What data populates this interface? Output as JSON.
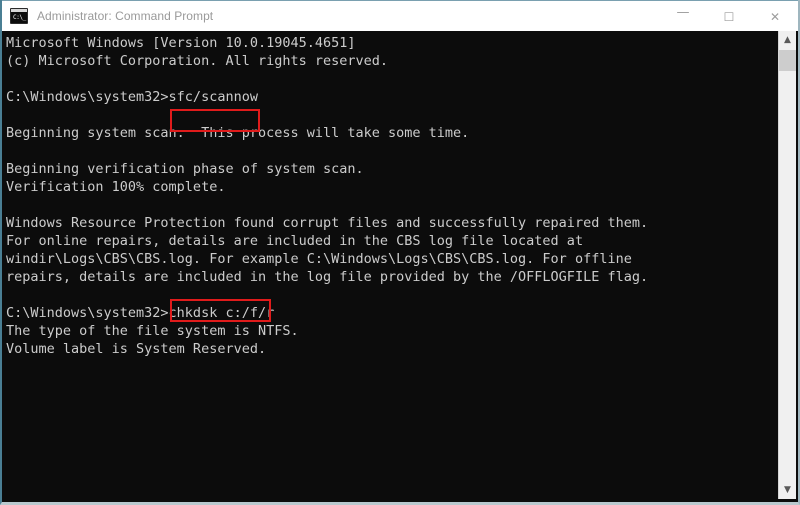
{
  "window": {
    "title": "Administrator: Command Prompt",
    "icon": "cmd-icon",
    "icon_prompt_text": "C:\\_",
    "controls": {
      "minimize": "—",
      "maximize": "☐",
      "close": "✕"
    }
  },
  "console": {
    "lines": [
      "Microsoft Windows [Version 10.0.19045.4651]",
      "(c) Microsoft Corporation. All rights reserved.",
      "",
      "C:\\Windows\\system32>sfc/scannow",
      "",
      "Beginning system scan.  This process will take some time.",
      "",
      "Beginning verification phase of system scan.",
      "Verification 100% complete.",
      "",
      "Windows Resource Protection found corrupt files and successfully repaired them.",
      "For online repairs, details are included in the CBS log file located at",
      "windir\\Logs\\CBS\\CBS.log. For example C:\\Windows\\Logs\\CBS\\CBS.log. For offline",
      "repairs, details are included in the log file provided by the /OFFLOGFILE flag.",
      "",
      "C:\\Windows\\system32>chkdsk c:/f/r",
      "The type of the file system is NTFS.",
      "Volume label is System Reserved."
    ],
    "prompt_path": "C:\\Windows\\system32>",
    "commands": [
      "sfc/scannow",
      "chkdsk c:/f/r"
    ],
    "text_color": "#cccccc",
    "background_color": "#0c0c0c"
  },
  "annotations": {
    "highlight_color": "#e01b1b",
    "boxes": [
      {
        "label": "sfc/scannow"
      },
      {
        "label": "chkdsk c:/f/r"
      }
    ]
  },
  "scrollbar": {
    "up_arrow": "▲",
    "down_arrow": "▼"
  }
}
